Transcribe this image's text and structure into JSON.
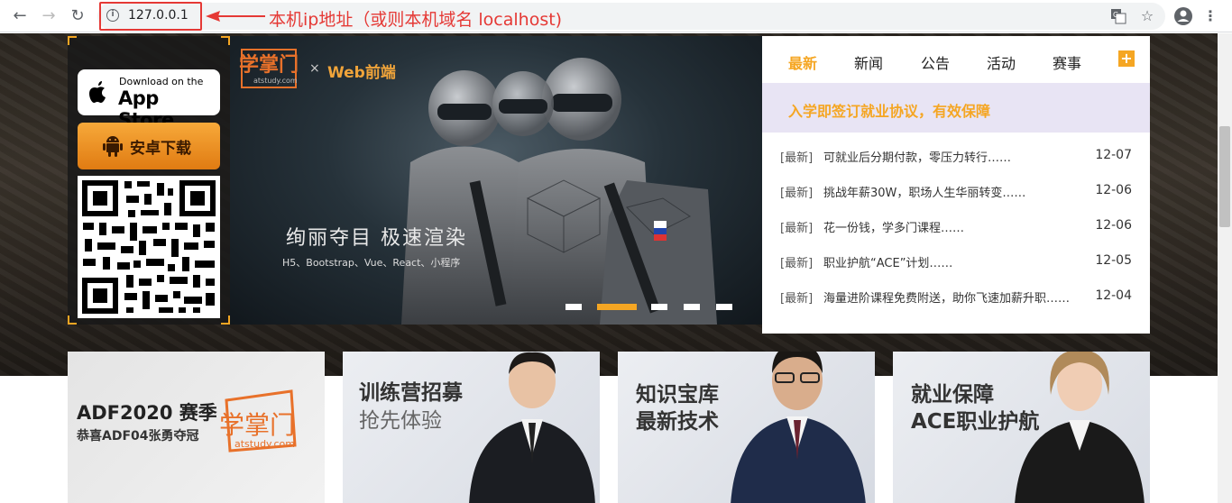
{
  "browser": {
    "address": "127.0.0.1",
    "annotation": "本机ip地址（或则本机域名 localhost)"
  },
  "app": {
    "appstore_small": "Download on the",
    "appstore_big": "App Store",
    "android_label": "安卓下载"
  },
  "banner": {
    "logo": "学掌门",
    "logo_sub": "atstudy.com",
    "x": "×",
    "partner": "Web前端",
    "slogan": "绚丽夺目  极速渲染",
    "techs": "H5、Bootstrap、Vue、React、小程序",
    "slides": 5,
    "active_slide": 2
  },
  "news": {
    "tabs": [
      "最新",
      "新闻",
      "公告",
      "活动",
      "赛事"
    ],
    "active_tab": 0,
    "headline": "入学即签订就业协议，有效保障",
    "items": [
      {
        "tag": "[最新]",
        "title": "可就业后分期付款，零压力转行……",
        "date": "12-07"
      },
      {
        "tag": "[最新]",
        "title": "挑战年薪30W，职场人生华丽转变……",
        "date": "12-06"
      },
      {
        "tag": "[最新]",
        "title": "花一份钱，学多门课程……",
        "date": "12-06"
      },
      {
        "tag": "[最新]",
        "title": "职业护航“ACE”计划……",
        "date": "12-05"
      },
      {
        "tag": "[最新]",
        "title": "海量进阶课程免费附送，助你飞速加薪升职……",
        "date": "12-04"
      }
    ]
  },
  "cards": [
    {
      "line1": "ADF2020 赛季",
      "line2": "恭喜ADF04张勇夺冠",
      "logo": "学掌门",
      "logo_sub": "atstudy.com"
    },
    {
      "line1": "训练营招募",
      "line2": "抢先体验"
    },
    {
      "line1": "知识宝库",
      "line2": "最新技术"
    },
    {
      "line1": "就业保障",
      "line2": "ACE职业护航"
    }
  ],
  "colors": {
    "accent": "#f5a623",
    "annotation": "#e53935"
  }
}
